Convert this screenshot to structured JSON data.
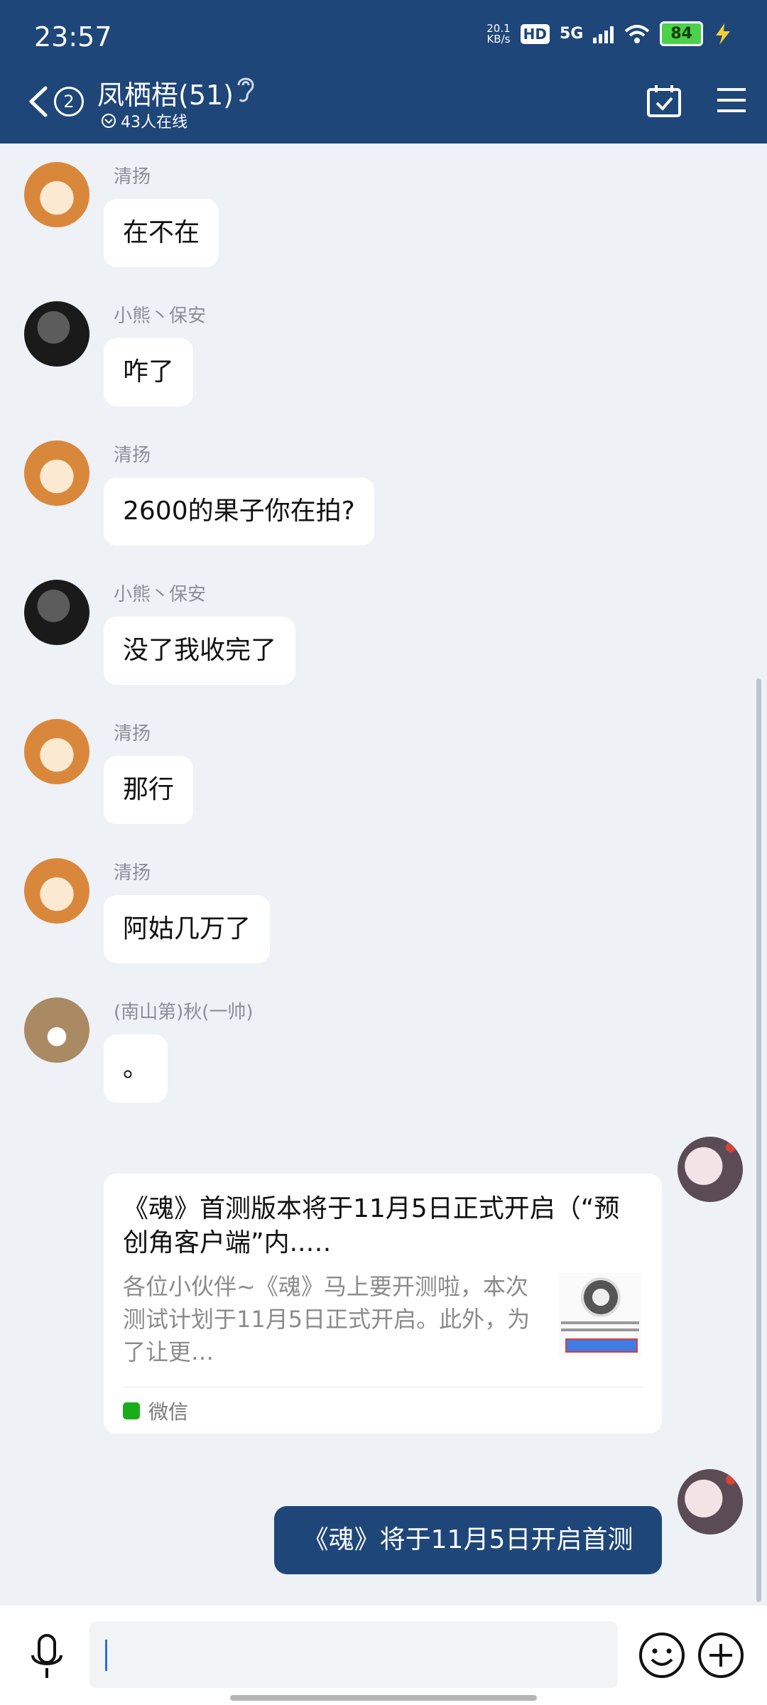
{
  "status_bar": {
    "time": "23:57",
    "net_speed_value": "20.1",
    "net_speed_unit": "KB/s",
    "hd_label": "HD",
    "network": "5G",
    "battery": "84"
  },
  "header": {
    "unread_count": "2",
    "group_name": "凤栖梧(51)",
    "online_text": "43人在线"
  },
  "messages": [
    {
      "sender": "清扬",
      "text": "在不在",
      "avatar": "dog"
    },
    {
      "sender": "小熊丶保安",
      "text": "咋了",
      "avatar": "dark"
    },
    {
      "sender": "清扬",
      "text": "2600的果子你在拍?",
      "avatar": "dog"
    },
    {
      "sender": "小熊丶保安",
      "text": "没了我收完了",
      "avatar": "dark"
    },
    {
      "sender": "清扬",
      "text": "那行",
      "avatar": "dog"
    },
    {
      "sender": "清扬",
      "text": "阿姑几万了",
      "avatar": "dog"
    },
    {
      "sender": "(南山第)秋(一帅)",
      "text": "。",
      "avatar": "cat"
    }
  ],
  "share_card": {
    "title": "《魂》首测版本将于11月5日正式开启（“预创角客户端”内..…",
    "description": "各位小伙伴~《魂》马上要开测啦，本次测试计划于11月5日正式开启。此外，为了让更…",
    "source": "微信"
  },
  "own_message": {
    "text": "《魂》将于11月5日开启首测"
  },
  "input": {
    "placeholder": ""
  }
}
